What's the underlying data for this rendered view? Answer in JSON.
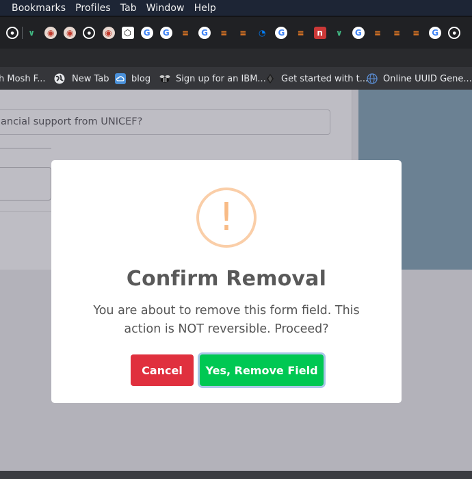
{
  "menubar": {
    "items": [
      "Bookmarks",
      "Profiles",
      "Tab",
      "Window",
      "Help"
    ]
  },
  "tabs": {
    "icons": [
      "github-icon",
      "vue-icon",
      "record-icon",
      "record-icon",
      "github-icon",
      "record-icon",
      "codepen-icon",
      "google-icon",
      "google-icon",
      "stackoverflow-icon",
      "google-icon",
      "stackoverflow-icon",
      "stackoverflow-icon",
      "digitalocean-icon",
      "google-icon",
      "stackoverflow-icon",
      "npm-icon",
      "vue-icon",
      "google-icon",
      "stackoverflow-icon",
      "stackoverflow-icon",
      "stackoverflow-icon",
      "google-icon",
      "github-icon"
    ]
  },
  "bookmarks": {
    "items": [
      {
        "label": "h Mosh F...",
        "icon": "none"
      },
      {
        "label": "New Tab",
        "icon": "globe-icon"
      },
      {
        "label": "blog",
        "icon": "cloud-icon"
      },
      {
        "label": "Sign up for an IBM...",
        "icon": "bee-icon"
      },
      {
        "label": "Get started with t...",
        "icon": "diamond-icon"
      },
      {
        "label": "Online UUID Gene...",
        "icon": "globe-icon"
      }
    ]
  },
  "page": {
    "field_text": "ancial support from UNICEF?"
  },
  "modal": {
    "icon_glyph": "!",
    "title": "Confirm Removal",
    "text": "You are about to remove this form field. This action is NOT reversible. Proceed?",
    "cancel_label": "Cancel",
    "confirm_label": "Yes, Remove Field"
  },
  "colors": {
    "cancel": "#e0303e",
    "confirm": "#00c853",
    "warning": "#f8bb86"
  }
}
